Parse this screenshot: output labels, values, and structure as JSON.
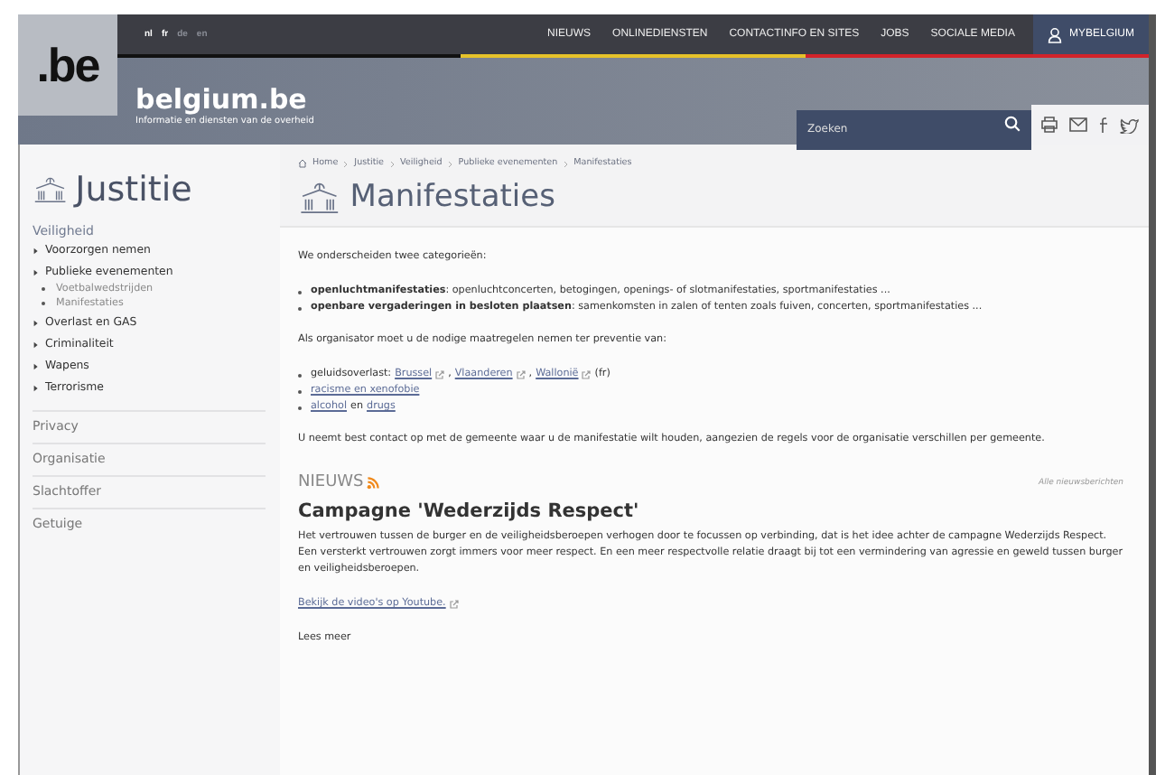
{
  "languages": [
    {
      "code": "nl",
      "enabled": true
    },
    {
      "code": "fr",
      "enabled": true
    },
    {
      "code": "de",
      "enabled": false
    },
    {
      "code": "en",
      "enabled": false
    }
  ],
  "top_nav": [
    "NIEUWS",
    "ONLINEDIENSTEN",
    "CONTACTINFO EN SITES",
    "JOBS",
    "SOCIALE MEDIA"
  ],
  "account_link": "MYBELGIUM",
  "logo": ".be",
  "site": {
    "title": "belgium.be",
    "subtitle": "Informatie en diensten van de overheid"
  },
  "search": {
    "placeholder": "Zoeken"
  },
  "sidebar": {
    "title": "Justitie",
    "section": "Veiligheid",
    "items": [
      {
        "label": "Voorzorgen nemen"
      },
      {
        "label": "Publieke evenementen",
        "children": [
          "Voetbalwedstrijden",
          "Manifestaties"
        ]
      },
      {
        "label": "Overlast en GAS"
      },
      {
        "label": "Criminaliteit"
      },
      {
        "label": "Wapens"
      },
      {
        "label": "Terrorisme"
      }
    ],
    "links": [
      "Privacy",
      "Organisatie",
      "Slachtoffer",
      "Getuige"
    ]
  },
  "breadcrumb": [
    "Home",
    "Justitie",
    "Veiligheid",
    "Publieke evenementen",
    "Manifestaties"
  ],
  "page_title": "Manifestaties",
  "intro": "We onderscheiden twee categorieën:",
  "categories": [
    "**openluchtmanifestaties**: openluchtconcerten, betogingen, openings- of slotmanifestaties, sportmanifestaties ...",
    "**openbare vergaderingen in besloten plaatsen**: samenkomsten in zalen of tenten zoals fuiven, concerten, sportmanifestaties ..."
  ],
  "prevention_intro": "Als organisator moet u de nodige maatregelen nemen ter preventie van:",
  "prevention": [
    [
      {
        "kind": "text",
        "text": "geluidsoverlast:"
      },
      {
        "kind": "external",
        "text": "Brussel"
      },
      {
        "kind": "text",
        "text": ","
      },
      {
        "kind": "external",
        "text": "Vlaanderen"
      },
      {
        "kind": "text",
        "text": ","
      },
      {
        "kind": "external",
        "text": "Wallonië"
      },
      {
        "kind": "text",
        "text": "(fr)"
      }
    ],
    [
      {
        "kind": "link",
        "text": "racisme en xenofobie"
      }
    ],
    [
      {
        "kind": "link",
        "text": "alcohol"
      },
      {
        "kind": "text",
        "text": "en"
      },
      {
        "kind": "link",
        "text": "drugs"
      }
    ]
  ],
  "contact_note": "U neemt best contact op met de gemeente waar u de manifestatie wilt houden, aangezien de regels voor de organisatie verschillen per gemeente.",
  "news": {
    "heading": "NIEUWS",
    "all_link": "Alle nieuwsberichten",
    "title": "Campagne 'Wederzijds Respect'",
    "body": "Het vertrouwen tussen de burger en de veiligheidsberoepen verhogen door te focussen op verbinding, dat is het idee achter de campagne Wederzijds Respect. Een versterkt vertrouwen zorgt immers voor meer respect. En een meer respectvolle relatie draagt bij tot een vermindering van agressie en geweld tussen burger en veiligheidsberoepen.",
    "video_link": "Bekijk de video's op Youtube.",
    "read_more": "Lees meer"
  }
}
